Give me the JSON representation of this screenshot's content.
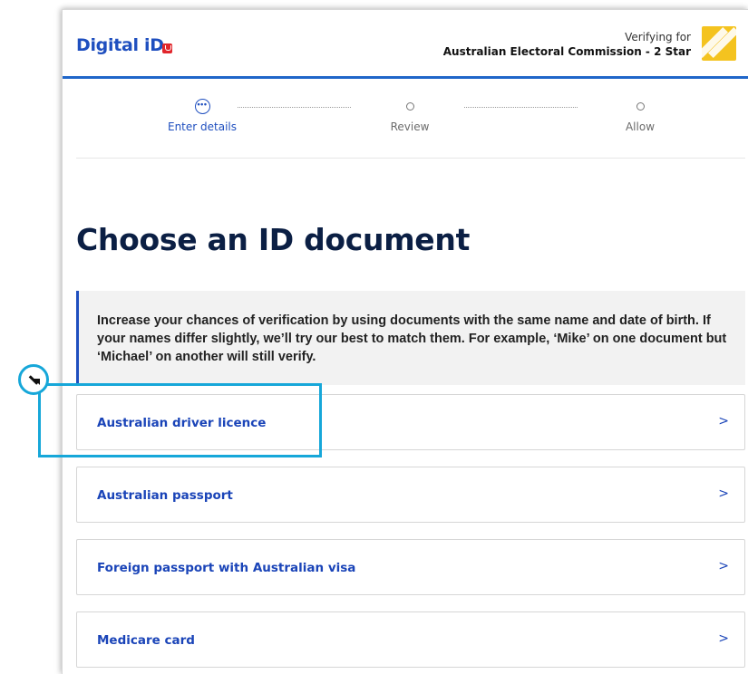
{
  "header": {
    "logo_text": "Digital iD",
    "verifying_for_label": "Verifying for",
    "organisation": "Australian Electoral Commission - 2 Star"
  },
  "stepper": {
    "steps": [
      {
        "label": "Enter details",
        "state": "active"
      },
      {
        "label": "Review",
        "state": "pending"
      },
      {
        "label": "Allow",
        "state": "pending"
      }
    ]
  },
  "main": {
    "title": "Choose an ID document",
    "info_text": "Increase your chances of verification by using documents with the same name and date of birth. If your names differ slightly, we’ll try our best to match them. For example, ‘Mike’ on one document but ‘Michael’ on another will still verify.",
    "options": [
      {
        "label": "Australian driver licence",
        "chevron": ">"
      },
      {
        "label": "Australian passport",
        "chevron": ">"
      },
      {
        "label": "Foreign passport with Australian visa",
        "chevron": ">"
      },
      {
        "label": "Medicare card",
        "chevron": ">"
      }
    ]
  },
  "colors": {
    "brand_blue": "#1f4fbf",
    "title_navy": "#0b1f44",
    "annotation_cyan": "#16a7d9",
    "rp_logo_yellow": "#f4c31f"
  }
}
